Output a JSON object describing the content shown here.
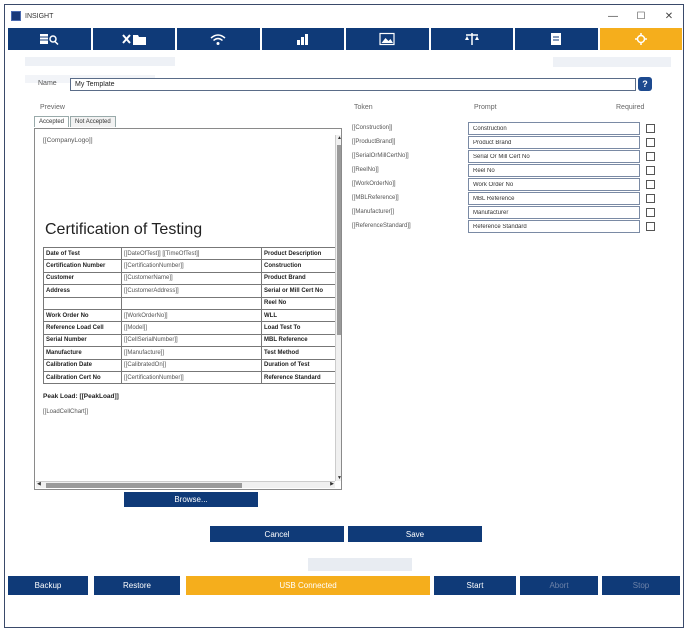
{
  "window": {
    "title": "INSIGHT",
    "minimize": "—",
    "maximize": "☐",
    "close": "✕"
  },
  "nav": [
    {
      "icon": "database-search-icon"
    },
    {
      "icon": "tools-folder-icon"
    },
    {
      "icon": "wifi-icon"
    },
    {
      "icon": "bar-chart-icon"
    },
    {
      "icon": "image-icon"
    },
    {
      "icon": "scale-icon"
    },
    {
      "icon": "document-icon"
    },
    {
      "icon": "settings-icon",
      "active": true
    }
  ],
  "form": {
    "name_label": "Name",
    "name_value": "My Template",
    "help_label": "?",
    "preview_label": "Preview",
    "token_label": "Token",
    "prompt_label": "Prompt",
    "required_label": "Required"
  },
  "tabs": [
    {
      "label": "Accepted",
      "active": true
    },
    {
      "label": "Not Accepted",
      "active": false
    }
  ],
  "preview": {
    "logo_token": "[[CompanyLogo]]",
    "title": "Certification of Testing",
    "rows": [
      [
        "Date of Test",
        "[[DateOfTest]] [[TimeOfTest]]",
        "Product Description"
      ],
      [
        "Certification Number",
        "[[CertificationNumber]]",
        "Construction"
      ],
      [
        "Customer",
        "[[CustomerName]]",
        "Product Brand"
      ],
      [
        "Address",
        "[[CustomerAddress]]",
        "Serial or Mill Cert No"
      ],
      [
        "",
        "",
        "Reel No"
      ],
      [
        "Work Order No",
        "[[WorkOrderNo]]",
        "WLL"
      ],
      [
        "Reference Load Cell",
        "[[Model]]",
        "Load Test To"
      ],
      [
        "Serial Number",
        "[[CellSerialNumber]]",
        "MBL Reference"
      ],
      [
        "Manufacture",
        "[[Manufacture]]",
        "Test Method"
      ],
      [
        "Calibration Date",
        "[[CalibratedOn]]",
        "Duration of Test"
      ],
      [
        "Calibration Cert No",
        "[[CertificationNumber]]",
        "Reference Standard"
      ]
    ],
    "peak_load": "Peak Load: [[PeakLoad]]",
    "chart_token": "[[LoadCellChart]]"
  },
  "tokens": [
    {
      "token": "[[Construction]]",
      "prompt": "Construction"
    },
    {
      "token": "[[ProductBrand]]",
      "prompt": "Product Brand"
    },
    {
      "token": "[[SerialOrMillCertNo]]",
      "prompt": "Serial Or Mill Cert No"
    },
    {
      "token": "[[ReelNo]]",
      "prompt": "Reel No"
    },
    {
      "token": "[[WorkOrderNo]]",
      "prompt": "Work Order No"
    },
    {
      "token": "[[MBLReference]]",
      "prompt": "MBL Reference"
    },
    {
      "token": "[[Manufacturer]]",
      "prompt": "Manufacturer"
    },
    {
      "token": "[[ReferenceStandard]]",
      "prompt": "Reference Standard"
    }
  ],
  "buttons": {
    "browse": "Browse...",
    "cancel": "Cancel",
    "save": "Save"
  },
  "bottom": {
    "backup": "Backup",
    "restore": "Restore",
    "usb": "USB Connected",
    "start": "Start",
    "abort": "Abort",
    "stop": "Stop"
  },
  "colors": {
    "primary": "#0f3a78",
    "accent": "#f5ae1c"
  }
}
